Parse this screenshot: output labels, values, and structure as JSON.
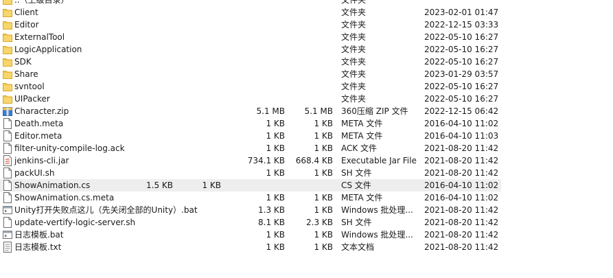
{
  "files": [
    {
      "name": "..（上级目录）",
      "size": "",
      "packed": "",
      "type": "文件夹",
      "modified": "",
      "icon": "folder-icon"
    },
    {
      "name": "Client",
      "size": "",
      "packed": "",
      "type": "文件夹",
      "modified": "2023-02-01 01:47",
      "icon": "folder-icon"
    },
    {
      "name": "Editor",
      "size": "",
      "packed": "",
      "type": "文件夹",
      "modified": "2022-12-15 03:33",
      "icon": "folder-icon"
    },
    {
      "name": "ExternalTool",
      "size": "",
      "packed": "",
      "type": "文件夹",
      "modified": "2022-05-10 16:27",
      "icon": "folder-icon"
    },
    {
      "name": "LogicApplication",
      "size": "",
      "packed": "",
      "type": "文件夹",
      "modified": "2022-05-10 16:27",
      "icon": "folder-icon"
    },
    {
      "name": "SDK",
      "size": "",
      "packed": "",
      "type": "文件夹",
      "modified": "2022-05-10 16:27",
      "icon": "folder-icon"
    },
    {
      "name": "Share",
      "size": "",
      "packed": "",
      "type": "文件夹",
      "modified": "2023-01-29 03:57",
      "icon": "folder-icon"
    },
    {
      "name": "svntool",
      "size": "",
      "packed": "",
      "type": "文件夹",
      "modified": "2022-05-10 16:27",
      "icon": "folder-icon"
    },
    {
      "name": "UIPacker",
      "size": "",
      "packed": "",
      "type": "文件夹",
      "modified": "2022-05-10 16:27",
      "icon": "folder-icon"
    },
    {
      "name": "Character.zip",
      "size": "5.1 MB",
      "packed": "5.1 MB",
      "type": "360压缩 ZIP 文件",
      "modified": "2022-12-15 06:42",
      "icon": "zip-archive-icon"
    },
    {
      "name": "Death.meta",
      "size": "1 KB",
      "packed": "1 KB",
      "type": "META 文件",
      "modified": "2016-04-10 11:02",
      "icon": "file-icon"
    },
    {
      "name": "Editor.meta",
      "size": "1 KB",
      "packed": "1 KB",
      "type": "META 文件",
      "modified": "2016-04-10 11:03",
      "icon": "file-icon"
    },
    {
      "name": "filter-unity-compile-log.ack",
      "size": "1 KB",
      "packed": "1 KB",
      "type": "ACK 文件",
      "modified": "2021-08-20 11:42",
      "icon": "file-icon"
    },
    {
      "name": "jenkins-cli.jar",
      "size": "734.1 KB",
      "packed": "668.4 KB",
      "type": "Executable Jar File",
      "modified": "2021-08-20 11:42",
      "icon": "jar-file-icon"
    },
    {
      "name": "packUI.sh",
      "size": "1 KB",
      "packed": "1 KB",
      "type": "SH 文件",
      "modified": "2021-08-20 11:42",
      "icon": "file-icon"
    },
    {
      "name": "ShowAnimation.cs",
      "size": "1.5 KB",
      "packed": "1 KB",
      "type": "CS 文件",
      "modified": "2016-04-10 11:02",
      "icon": "file-icon",
      "hover": true
    },
    {
      "name": "ShowAnimation.cs.meta",
      "size": "1 KB",
      "packed": "1 KB",
      "type": "META 文件",
      "modified": "2016-04-10 11:02",
      "icon": "file-icon"
    },
    {
      "name": "Unity打开失败点这儿（先关闭全部的Unity）.bat",
      "size": "1.3 KB",
      "packed": "1 KB",
      "type": "Windows 批处理...",
      "modified": "2021-08-20 11:42",
      "icon": "batch-file-icon"
    },
    {
      "name": "update-vertify-logic-server.sh",
      "size": "8.1 KB",
      "packed": "2.3 KB",
      "type": "SH 文件",
      "modified": "2021-08-20 11:42",
      "icon": "file-icon"
    },
    {
      "name": "日志模板.bat",
      "size": "1 KB",
      "packed": "1 KB",
      "type": "Windows 批处理...",
      "modified": "2021-08-20 11:42",
      "icon": "batch-file-icon"
    },
    {
      "name": "日志模板.txt",
      "size": "1 KB",
      "packed": "1 KB",
      "type": "文本文档",
      "modified": "2021-08-20 11:42",
      "icon": "text-file-icon"
    }
  ],
  "colors": {
    "folder": "#f2c54b",
    "folder_dark": "#d9a72e",
    "hover_row": "#eeeeee",
    "zip_blue": "#3b7dd8"
  }
}
